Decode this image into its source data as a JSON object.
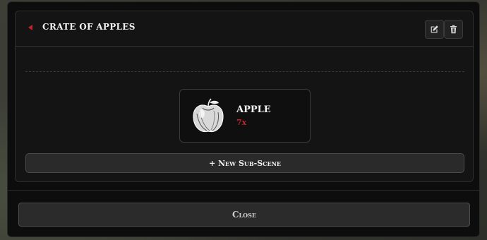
{
  "scene": {
    "title": "Crate of Apples",
    "edit_icon": "pencil-edit-icon",
    "delete_icon": "trash-icon"
  },
  "item": {
    "name": "Apple",
    "quantity": "7x",
    "image_icon": "apple-sketch-icon"
  },
  "buttons": {
    "new_sub_scene": "+ New Sub-Scene",
    "close": "Close"
  },
  "colors": {
    "accent": "#c0242a",
    "background": "#0d0d0d",
    "card": "#141414"
  }
}
